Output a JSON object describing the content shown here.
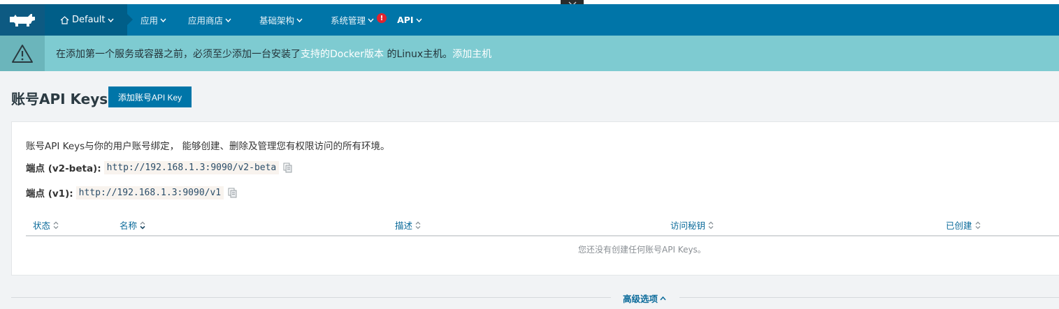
{
  "nav": {
    "environment": "Default",
    "items": [
      {
        "label": "应用",
        "has_caret": true
      },
      {
        "label": "应用商店",
        "has_caret": true
      },
      {
        "label": "基础架构",
        "has_caret": true
      },
      {
        "label": "系统管理",
        "has_caret": true,
        "alert": "!"
      },
      {
        "label": "API",
        "has_caret": true
      }
    ]
  },
  "banner": {
    "prefix": "在添加第一个服务或容器之前，必须至少添加一台安装了",
    "link_docker": "支持的Docker版本",
    "middle": " 的Linux主机。",
    "link_add_host": "添加主机"
  },
  "page": {
    "title": "账号API Keys",
    "add_button": "添加账号API Key"
  },
  "panel": {
    "description": "账号API Keys与你的用户账号绑定， 能够创建、删除及管理您有权限访问的所有环境。",
    "endpoint_v2_label": "端点 (v2-beta):",
    "endpoint_v2_url": "http://192.168.1.3:9090/v2-beta",
    "endpoint_v1_label": "端点 (v1):",
    "endpoint_v1_url": "http://192.168.1.3:9090/v1"
  },
  "table": {
    "columns": [
      "状态",
      "名称",
      "描述",
      "访问秘钥",
      "已创建"
    ],
    "empty_message": "您还没有创建任何账号API Keys。"
  },
  "advanced": {
    "label": "高级选项"
  },
  "colors": {
    "navbar": "#0075a8",
    "banner": "#7ecbd1",
    "accent": "#0075a8",
    "alert": "#e0242f"
  }
}
